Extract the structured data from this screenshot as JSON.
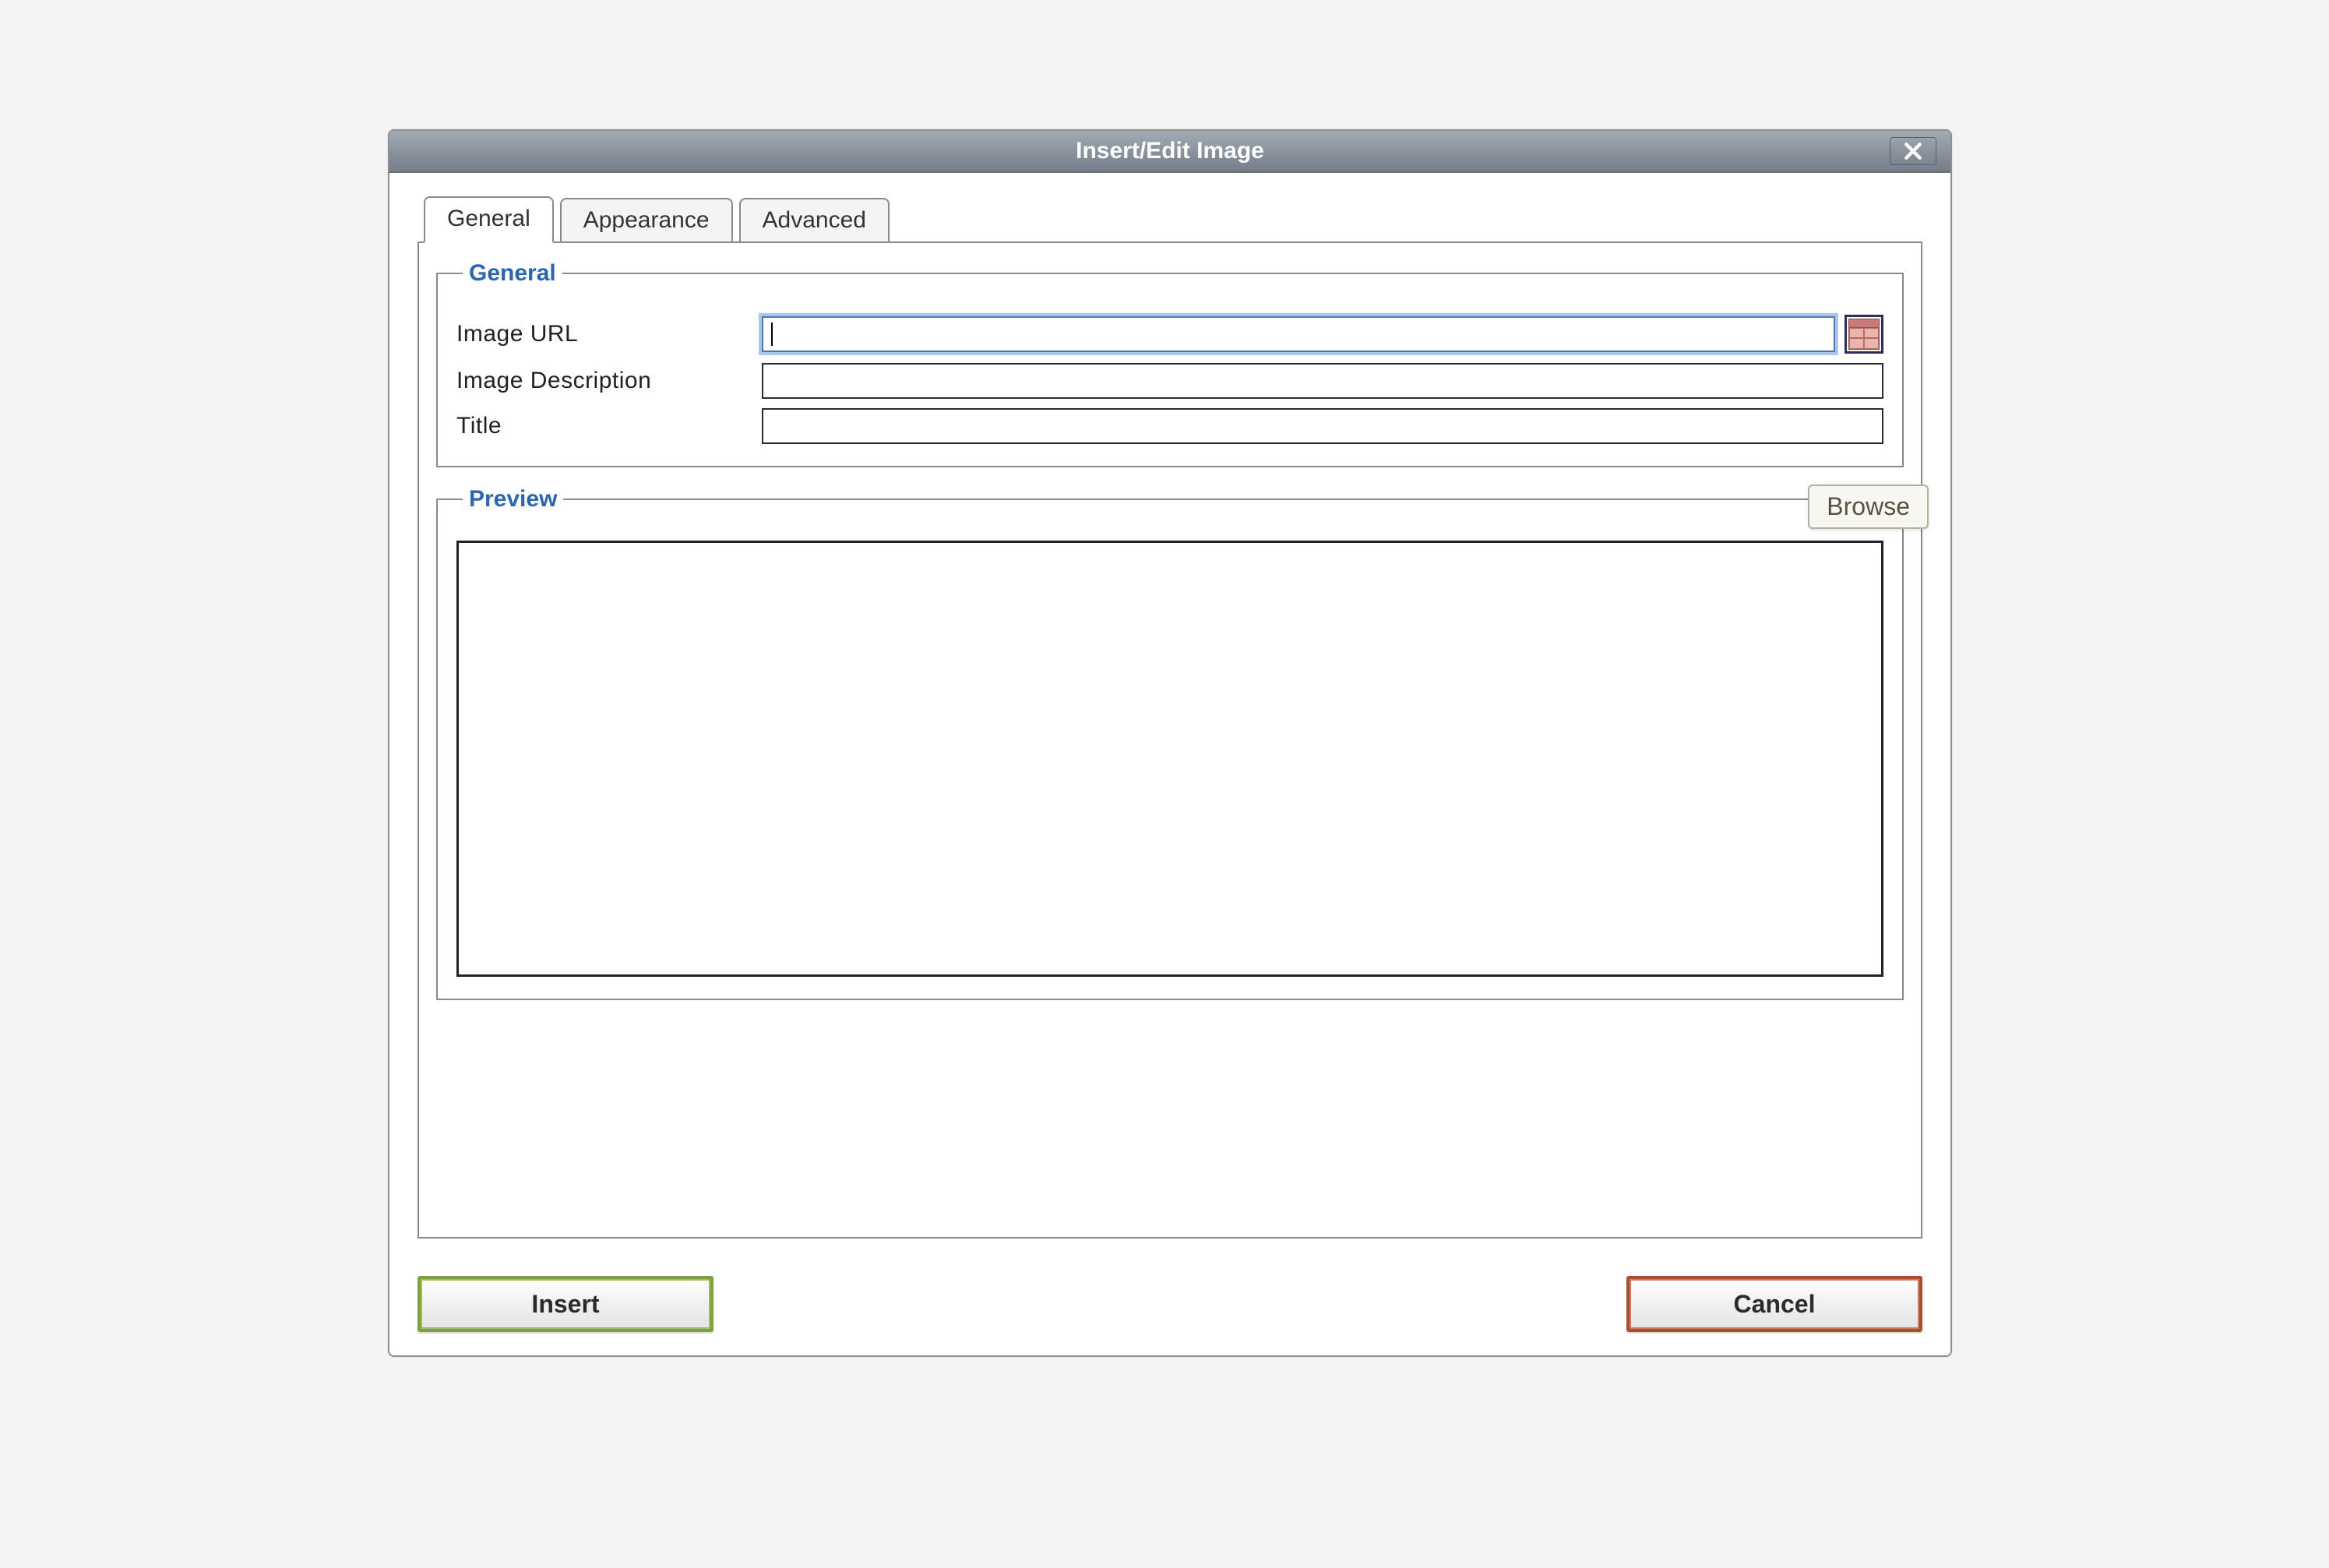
{
  "dialog": {
    "title": "Insert/Edit Image",
    "close_label": "Close"
  },
  "tabs": {
    "general": "General",
    "appearance": "Appearance",
    "advanced": "Advanced"
  },
  "fieldset": {
    "general_legend": "General",
    "preview_legend": "Preview"
  },
  "fields": {
    "image_url_label": "Image URL",
    "image_url_value": "",
    "image_description_label": "Image Description",
    "image_description_value": "",
    "title_label": "Title",
    "title_value": ""
  },
  "tooltip": {
    "browse": "Browse"
  },
  "buttons": {
    "insert": "Insert",
    "cancel": "Cancel"
  }
}
